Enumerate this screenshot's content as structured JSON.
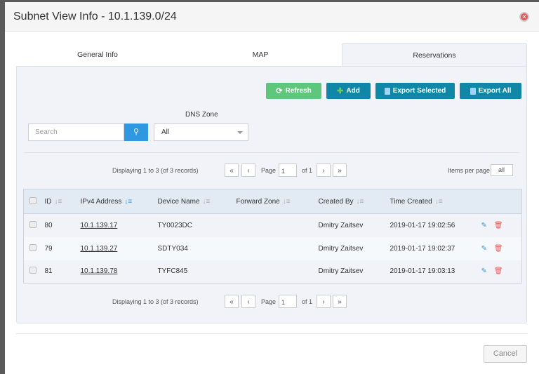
{
  "title": "Subnet View Info - 10.1.139.0/24",
  "tabs": [
    "General Info",
    "MAP",
    "Reservations"
  ],
  "buttons": {
    "refresh": "Refresh",
    "add": "Add",
    "export_selected": "Export Selected",
    "export_all": "Export All",
    "cancel": "Cancel"
  },
  "search": {
    "placeholder": "Search"
  },
  "dns_zone": {
    "label": "DNS Zone",
    "value": "All"
  },
  "pager": {
    "displaying": "Displaying 1 to 3 (of 3 records)",
    "page_label": "Page",
    "page": "1",
    "of": "of 1",
    "items_per_page_label": "Items per page",
    "items_per_page": "all",
    "first": "«",
    "prev": "‹",
    "next": "›",
    "last": "»"
  },
  "columns": [
    "ID",
    "IPv4 Address",
    "Device Name",
    "Forward Zone",
    "Created By",
    "Time Created"
  ],
  "rows": [
    {
      "id": "80",
      "ip": "10.1.139.17",
      "device": "TY0023DC",
      "zone": "",
      "by": "Dmitry Zaitsev",
      "time": "2019-01-17 19:02:56"
    },
    {
      "id": "79",
      "ip": "10.1.139.27",
      "device": "SDTY034",
      "zone": "",
      "by": "Dmitry Zaitsev",
      "time": "2019-01-17 19:02:37"
    },
    {
      "id": "81",
      "ip": "10.1.139.78",
      "device": "TYFC845",
      "zone": "",
      "by": "Dmitry Zaitsev",
      "time": "2019-01-17 19:03:13"
    }
  ],
  "colors": {
    "primary": "#1187a8",
    "success": "#5ec77c",
    "search": "#2f98e0",
    "delete": "#ee5555"
  }
}
